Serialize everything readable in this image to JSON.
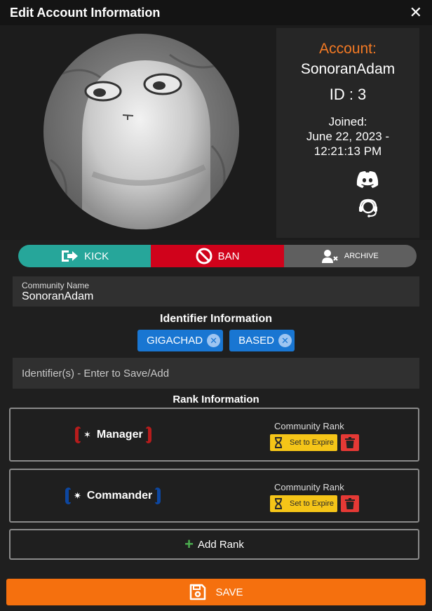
{
  "window": {
    "title": "Edit Account Information",
    "close_label": "✕"
  },
  "account": {
    "label": "Account:",
    "name": "SonoranAdam",
    "id_text": "ID : 3",
    "joined_label": "Joined:",
    "joined_value": "June 22, 2023 - 12:21:13 PM",
    "icons": [
      "discord-icon",
      "support-headset-icon"
    ]
  },
  "actions": {
    "kick_label": "KICK",
    "ban_label": "BAN",
    "archive_label": "ARCHIVE"
  },
  "community_name": {
    "label": "Community Name",
    "value": "SonoranAdam"
  },
  "identifiers": {
    "heading": "Identifier Information",
    "chips": [
      "GIGACHAD",
      "BASED"
    ],
    "placeholder": "Identifier(s) - Enter to Save/Add"
  },
  "ranks": {
    "heading": "Rank Information",
    "items": [
      {
        "name": "Manager",
        "type": "Community Rank",
        "expire_label": "Set to Expire",
        "color": "#b71c1c"
      },
      {
        "name": "Commander",
        "type": "Community Rank",
        "expire_label": "Set to Expire",
        "color": "#0d47a1"
      }
    ],
    "add_label": "Add Rank"
  },
  "save_label": "SAVE",
  "colors": {
    "accent_orange": "#f5700e",
    "account_label": "#f47a24",
    "kick": "#26a69a",
    "ban": "#d0021b",
    "archive": "#5f5f5f",
    "chip": "#1976d2",
    "expire": "#f5c518",
    "delete": "#e53935"
  }
}
